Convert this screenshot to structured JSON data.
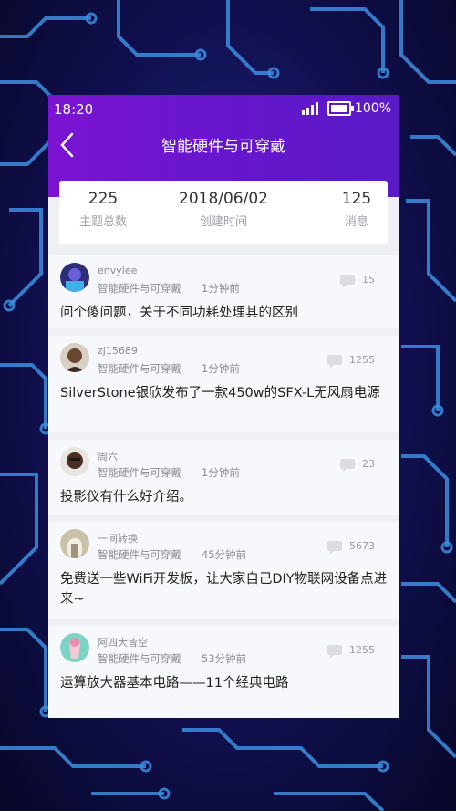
{
  "status": {
    "time": "18:20",
    "battery": "100%",
    "battery_level": 1.0
  },
  "header": {
    "title": "智能硬件与可穿戴",
    "back_icon": "chevron-left-icon"
  },
  "stats": [
    {
      "value": "225",
      "label": "主题总数"
    },
    {
      "value": "2018/06/02",
      "label": "创建时间"
    },
    {
      "value": "125",
      "label": "消息"
    }
  ],
  "posts": [
    {
      "user": "envylee",
      "category": "智能硬件与可穿戴",
      "time": "1分钟前",
      "comments": "15",
      "title": "问个傻问题，关于不同功耗处理其的区别"
    },
    {
      "user": "zj15689",
      "category": "智能硬件与可穿戴",
      "time": "1分钟前",
      "comments": "1255",
      "title": "SilverStone银欣发布了一款450w的SFX-L无风扇电源"
    },
    {
      "user": "周六",
      "category": "智能硬件与可穿戴",
      "time": "1分钟前",
      "comments": "23",
      "title": "投影仪有什么好介绍。"
    },
    {
      "user": "一间转换",
      "category": "智能硬件与可穿戴",
      "time": "45分钟前",
      "comments": "5673",
      "title": "免费送一些WiFi开发板，让大家自己DIY物联网设备点进来~"
    },
    {
      "user": "阿四大皆空",
      "category": "智能硬件与可穿戴",
      "time": "53分钟前",
      "comments": "1255",
      "title": "运算放大器基本电路——11个经典电路"
    }
  ],
  "colors": {
    "header_start": "#7a14d2",
    "header_end": "#5a1ac6",
    "circuit": "#3a8fd8"
  }
}
